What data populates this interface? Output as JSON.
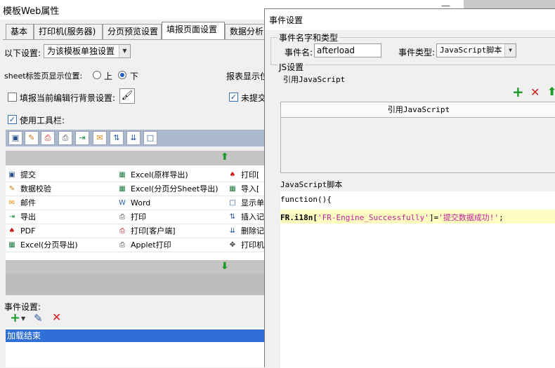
{
  "main_window": {
    "title": "模板Web属性",
    "tabs": [
      "基本",
      "打印机(服务器)",
      "分页预览设置",
      "填报页面设置",
      "数据分析"
    ],
    "settings_label": "以下设置:",
    "settings_combo": "为该模板单独设置",
    "sheet_pos_label": "sheet标签页显示位置:",
    "radio_top": "上",
    "radio_bottom": "下",
    "report_display_label": "报表显示位",
    "bg_setting_label": "填报当前编辑行背景设置:",
    "unsubmitted_label": "未提交",
    "use_toolbar_label": "使用工具栏:",
    "buttons": [
      {
        "label": "提交",
        "icon": "save-icon"
      },
      {
        "label": "数据校验",
        "icon": "pencil-icon"
      },
      {
        "label": "邮件",
        "icon": "mail-icon"
      },
      {
        "label": "导出",
        "icon": "export-icon"
      },
      {
        "label": "PDF",
        "icon": "pdf-icon"
      },
      {
        "label": "Excel(分页导出)",
        "icon": "excel-icon"
      },
      {
        "label": "Excel(原样导出)",
        "icon": "excel-icon"
      },
      {
        "label": "Excel(分页分Sheet导出)",
        "icon": "excel-icon"
      },
      {
        "label": "Word",
        "icon": "word-icon"
      },
      {
        "label": "打印",
        "icon": "printer-icon"
      },
      {
        "label": "打印[客户端]",
        "icon": "print-client-icon"
      },
      {
        "label": "Applet打印",
        "icon": "applet-print-icon"
      },
      {
        "label": "打印[",
        "icon": "pdf-icon"
      },
      {
        "label": "导入[",
        "icon": "excel-icon"
      },
      {
        "label": "显示单",
        "icon": "blank-icon"
      },
      {
        "label": "插入记",
        "icon": "insert-row-icon"
      },
      {
        "label": "删除记",
        "icon": "delete-row-icon"
      },
      {
        "label": "打印机",
        "icon": "move-icon"
      }
    ],
    "event_setting_label": "事件设置:",
    "events": [
      "加载结束"
    ]
  },
  "dialog": {
    "title": "事件设置",
    "event_group_label": "事件名字和类型",
    "event_name_label": "事件名:",
    "event_name_value": "afterload",
    "event_type_label": "事件类型:",
    "event_type_value": "JavaScript脚本",
    "js_group_label": "JS设置",
    "ref_js_label": "引用JavaScript",
    "ref_js_header": "引用JavaScript",
    "js_script_label": "JavaScript脚本",
    "code_line1": "function(){",
    "code_line2_prefix": "FR.i18n[",
    "code_line2_key": "'FR-Engine_Successfully'",
    "code_line2_mid": "]=",
    "code_line2_value": "'提交数据成功!'",
    "code_line2_suffix": ";"
  },
  "colors": {
    "accent_blue": "#2f6fd6",
    "add_green": "#1e9a2a",
    "delete_red": "#d42020",
    "code_highlight": "#fffcc2",
    "string_color": "#c41f9c"
  }
}
